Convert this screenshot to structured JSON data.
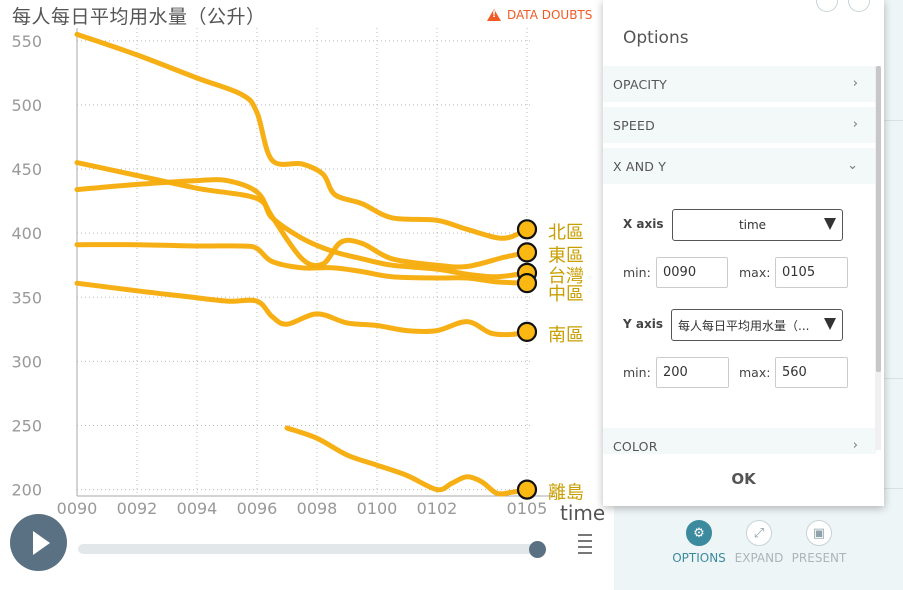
{
  "chart": {
    "y_title": "每人每日平均用水量（公升）",
    "x_title": "time",
    "data_doubts": "DATA DOUBTS",
    "line_color": "#f5ac0a",
    "point_color": "#fbb812",
    "label_color": "#c89e00"
  },
  "chart_data": {
    "type": "line",
    "ylim": [
      195,
      560
    ],
    "xlim": [
      90,
      105.2
    ],
    "y_ticks": [
      "550",
      "500",
      "450",
      "400",
      "350",
      "300",
      "250",
      "200"
    ],
    "x_ticks": [
      "0090",
      "0092",
      "0094",
      "0096",
      "0098",
      "0100",
      "0102",
      "0105"
    ],
    "grid": true,
    "series": [
      {
        "name": "北區",
        "x": [
          90,
          92,
          94,
          95.5,
          96,
          96.5,
          97.5,
          98.2,
          98.6,
          99.5,
          100.5,
          102,
          103,
          104.2,
          105
        ],
        "y": [
          555,
          539,
          521,
          508,
          494,
          457,
          454,
          446,
          430,
          423,
          412,
          410,
          403,
          396,
          403
        ]
      },
      {
        "name": "東區",
        "x": [
          90,
          92,
          94,
          95,
          96,
          96.5,
          97.5,
          98.2,
          98.8,
          99.5,
          100.5,
          102,
          103,
          104.2,
          105
        ],
        "y": [
          434,
          438,
          441,
          441,
          432,
          413,
          380,
          376,
          393,
          392,
          380,
          375,
          374,
          381,
          385
        ]
      },
      {
        "name": "台灣",
        "x": [
          90,
          92,
          94,
          96,
          96.5,
          97.5,
          98.5,
          99.5,
          100.5,
          102,
          103,
          104,
          105
        ],
        "y": [
          455,
          445,
          435,
          427,
          412,
          396,
          386,
          380,
          375,
          372,
          368,
          366,
          369
        ]
      },
      {
        "name": "中區",
        "x": [
          90,
          92,
          94,
          95.5,
          96,
          96.5,
          97.5,
          98.5,
          99.5,
          100.5,
          102,
          103,
          104,
          105
        ],
        "y": [
          391,
          391,
          390,
          390,
          388,
          378,
          373,
          373,
          370,
          366,
          365,
          365,
          362,
          361
        ]
      },
      {
        "name": "南區",
        "x": [
          90,
          92,
          93.5,
          95,
          96,
          96.5,
          97,
          98,
          99,
          100,
          101,
          102,
          103,
          103.8,
          104.5,
          105
        ],
        "y": [
          361,
          355,
          351,
          347,
          347,
          335,
          329,
          337,
          330,
          328,
          324,
          324,
          331,
          322,
          321,
          323
        ]
      },
      {
        "name": "離島",
        "x": [
          97,
          98,
          99,
          100,
          101,
          102,
          102.5,
          103,
          103.5,
          104,
          104.5,
          105
        ],
        "y": [
          248,
          240,
          227,
          219,
          211,
          200,
          205,
          210,
          206,
          197,
          198,
          200
        ]
      }
    ]
  },
  "timeslider": {
    "value_fraction": 1.0
  },
  "toolbar": {
    "options": "OPTIONS",
    "expand": "EXPAND",
    "present": "PRESENT"
  },
  "dialog": {
    "title": "Options",
    "sections": {
      "opacity": "OPACITY",
      "speed": "SPEED",
      "xy": "X AND Y",
      "color": "COLOR"
    },
    "x_axis": {
      "label": "X axis",
      "value": "time",
      "min_label": "min:",
      "min": "0090",
      "max_label": "max:",
      "max": "0105"
    },
    "y_axis": {
      "label": "Y axis",
      "value": "每人每日平均用水量（...",
      "min_label": "min:",
      "min": "200",
      "max_label": "max:",
      "max": "560"
    },
    "ok": "OK"
  }
}
